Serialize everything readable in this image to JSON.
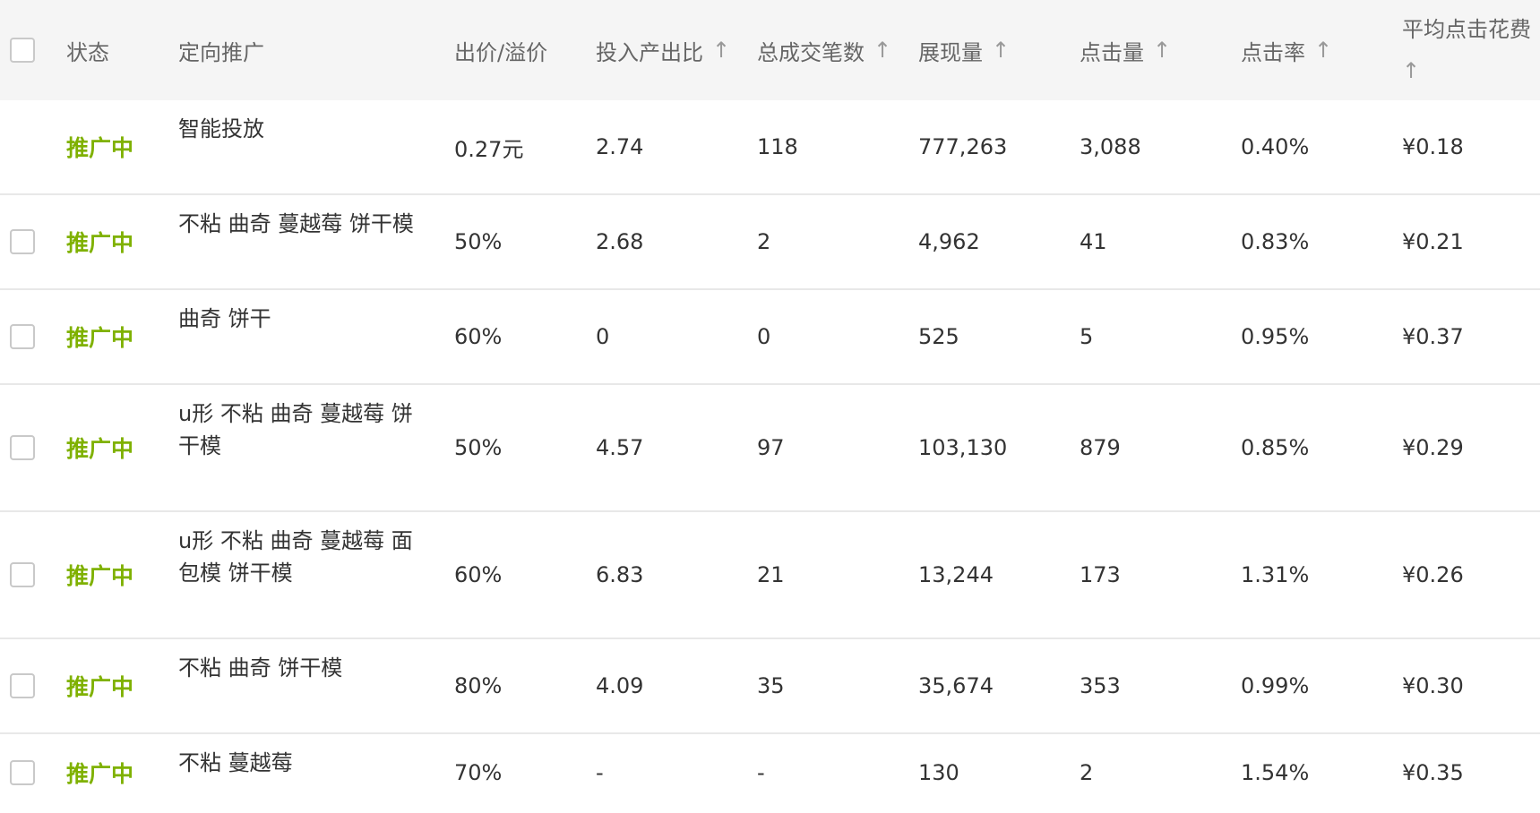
{
  "columns": {
    "status": "状态",
    "target": "定向推广",
    "bid": "出价/溢价",
    "roi": "投入产出比",
    "deals": "总成交笔数",
    "impressions": "展现量",
    "clicks": "点击量",
    "ctr": "点击率",
    "avg_cpc": "平均点击花费",
    "sort_arrow": "↑"
  },
  "rows": [
    {
      "has_checkbox": false,
      "status": "推广中",
      "target": "智能投放",
      "bid": "0.27元",
      "roi": "2.74",
      "deals": "118",
      "impressions": "777,263",
      "clicks": "3,088",
      "ctr": "0.40%",
      "avg_cpc": "¥0.18"
    },
    {
      "has_checkbox": true,
      "status": "推广中",
      "target": "不粘 曲奇 蔓越莓 饼干模",
      "bid": "50%",
      "roi": "2.68",
      "deals": "2",
      "impressions": "4,962",
      "clicks": "41",
      "ctr": "0.83%",
      "avg_cpc": "¥0.21"
    },
    {
      "has_checkbox": true,
      "status": "推广中",
      "target": "曲奇 饼干",
      "bid": "60%",
      "roi": "0",
      "deals": "0",
      "impressions": "525",
      "clicks": "5",
      "ctr": "0.95%",
      "avg_cpc": "¥0.37"
    },
    {
      "has_checkbox": true,
      "status": "推广中",
      "target": "u形 不粘 曲奇 蔓越莓 饼干模",
      "bid": "50%",
      "roi": "4.57",
      "deals": "97",
      "impressions": "103,130",
      "clicks": "879",
      "ctr": "0.85%",
      "avg_cpc": "¥0.29"
    },
    {
      "has_checkbox": true,
      "status": "推广中",
      "target": "u形 不粘 曲奇 蔓越莓 面包模 饼干模",
      "bid": "60%",
      "roi": "6.83",
      "deals": "21",
      "impressions": "13,244",
      "clicks": "173",
      "ctr": "1.31%",
      "avg_cpc": "¥0.26"
    },
    {
      "has_checkbox": true,
      "status": "推广中",
      "target": "不粘 曲奇 饼干模",
      "bid": "80%",
      "roi": "4.09",
      "deals": "35",
      "impressions": "35,674",
      "clicks": "353",
      "ctr": "0.99%",
      "avg_cpc": "¥0.30"
    },
    {
      "has_checkbox": true,
      "status": "推广中",
      "target": "不粘 蔓越莓",
      "bid": "70%",
      "roi": "-",
      "deals": "-",
      "impressions": "130",
      "clicks": "2",
      "ctr": "1.54%",
      "avg_cpc": "¥0.35"
    }
  ]
}
